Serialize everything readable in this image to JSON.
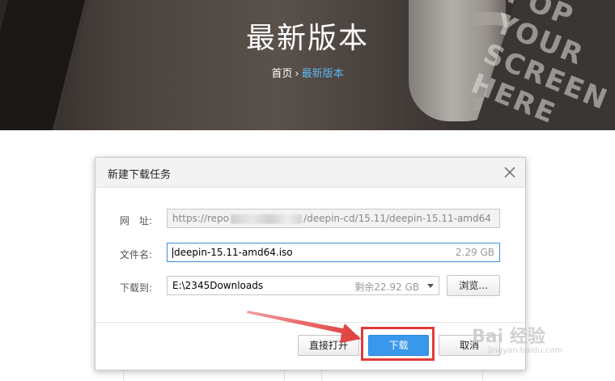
{
  "hero": {
    "title": "最新版本",
    "breadcrumb": {
      "home": "首页",
      "separator": "›",
      "current": "最新版本"
    },
    "sign_text": "POP YOUR SCREEN HERE",
    "accent_color": "#5bb8f0"
  },
  "dialog": {
    "title": "新建下载任务",
    "url": {
      "label": "网　址:",
      "value_prefix": "https://repo",
      "value_suffix": "/deepin-cd/15.11/deepin-15.11-amd64"
    },
    "filename": {
      "label": "文件名:",
      "value": "deepin-15.11-amd64.iso",
      "size": "2.29 GB"
    },
    "save_to": {
      "label": "下载到:",
      "value": "E:\\2345Downloads",
      "free_space": "剩余22.92 GB",
      "browse_label": "浏览..."
    },
    "buttons": {
      "open_direct": "直接打开",
      "download": "下载",
      "cancel": "取消"
    },
    "primary_color": "#3a98ec",
    "highlight_color": "#e23a3a"
  },
  "watermark": {
    "main": "Bai 经验",
    "sub": "jingyan.baidu.com"
  }
}
